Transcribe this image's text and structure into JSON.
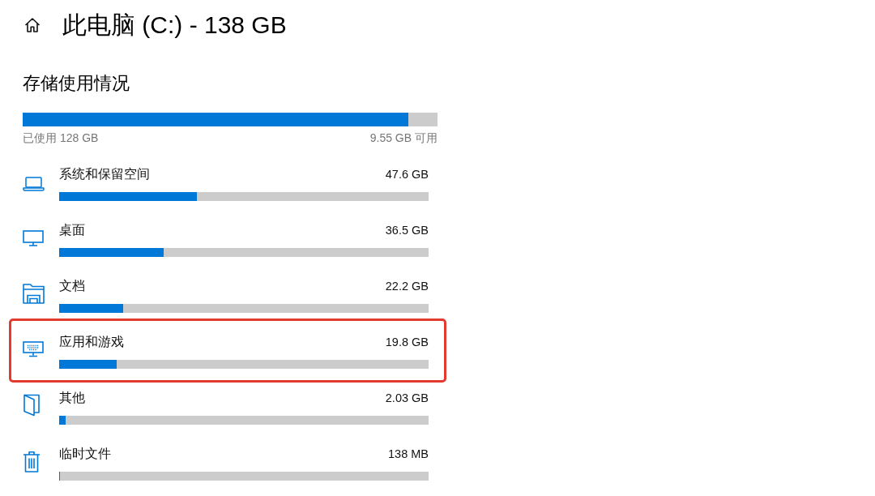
{
  "header": {
    "title": "此电脑 (C:) - 138 GB"
  },
  "storage_usage": {
    "heading": "存储使用情况",
    "level": 0.93,
    "used_label": "已使用 128 GB",
    "free_label": "9.55 GB 可用"
  },
  "categories": [
    {
      "kind": "system",
      "name": "系统和保留空间",
      "size": "47.6 GB",
      "level": 0.373,
      "highlighted": false
    },
    {
      "kind": "desktop",
      "name": "桌面",
      "size": "36.5 GB",
      "level": 0.283,
      "highlighted": false
    },
    {
      "kind": "documents",
      "name": "文档",
      "size": "22.2 GB",
      "level": 0.173,
      "highlighted": false
    },
    {
      "kind": "apps",
      "name": "应用和游戏",
      "size": "19.8 GB",
      "level": 0.156,
      "highlighted": true
    },
    {
      "kind": "other",
      "name": "其他",
      "size": "2.03 GB",
      "level": 0.018,
      "highlighted": false
    },
    {
      "kind": "temp",
      "name": "临时文件",
      "size": "138 MB",
      "level": 0.003,
      "highlighted": false
    }
  ]
}
